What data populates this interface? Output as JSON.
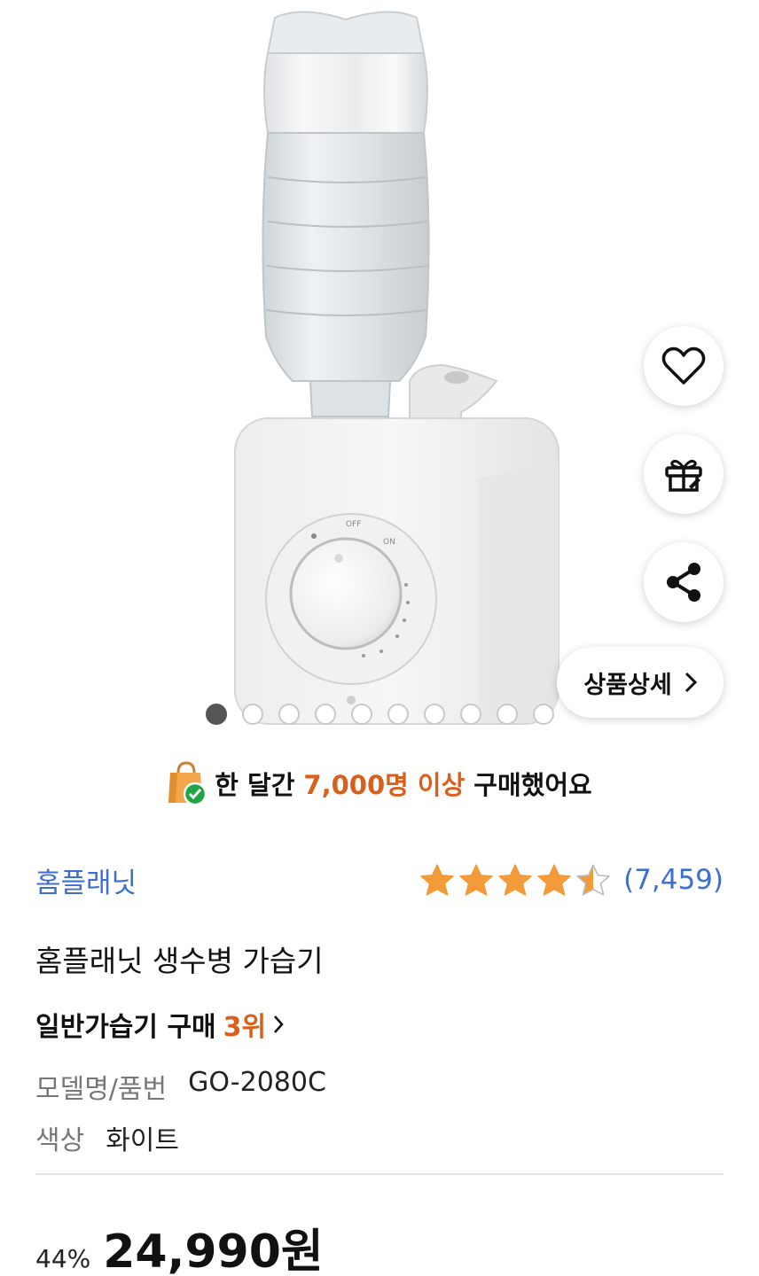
{
  "actions": {
    "wishlist_icon": "heart-icon",
    "gift_icon": "gift-icon",
    "share_icon": "share-icon",
    "detail_label": "상품상세"
  },
  "gallery": {
    "total_images": 10,
    "active_index": 0
  },
  "banner": {
    "prefix": "한 달간",
    "highlight": "7,000명 이상",
    "suffix": "구매했어요"
  },
  "product": {
    "brand": "홈플래닛",
    "rating": {
      "stars": 4.5,
      "count": "(7,459)"
    },
    "name": "홈플래닛 생수병 가습기",
    "ranking": {
      "prefix": "일반가습기 구매",
      "rank": "3위"
    },
    "specs": [
      {
        "label": "모델명/품번",
        "value": "GO-2080C"
      },
      {
        "label": "색상",
        "value": "화이트"
      }
    ],
    "price": {
      "discount": "44%",
      "amount": "24,990원"
    }
  },
  "colors": {
    "accent": "#d9601c",
    "link": "#3d6fd0",
    "star": "#f29b38"
  }
}
